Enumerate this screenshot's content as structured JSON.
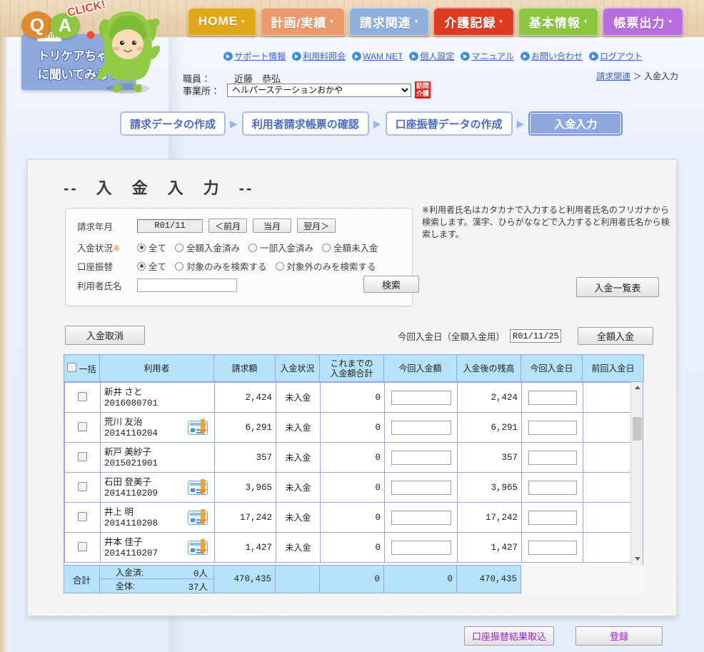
{
  "nav": {
    "tabs": [
      {
        "label": "HOME",
        "color": "#e0a818",
        "caret": "▾"
      },
      {
        "label": "計画/実績",
        "color": "#eb9a6b",
        "caret": "▾"
      },
      {
        "label": "請求関連",
        "color": "#8fb0dd",
        "caret": "▾"
      },
      {
        "label": "介護記録",
        "color": "#dd3c22",
        "caret": "▾"
      },
      {
        "label": "基本情報",
        "color": "#8cc63f",
        "caret": "▾"
      },
      {
        "label": "帳票出力",
        "color": "#b66ee0",
        "caret": "▾"
      }
    ]
  },
  "logo": {
    "q": "Q",
    "a": "A",
    "click": "CLICK!",
    "and": "and",
    "line1": "トリケアちゃん",
    "line2": "に聞いてみる！"
  },
  "header_links": [
    {
      "label": "サポート情報"
    },
    {
      "label": "利用料照会"
    },
    {
      "label": "WAM NET"
    },
    {
      "label": "個人設定"
    },
    {
      "label": "マニュアル"
    },
    {
      "label": "お問い合わせ"
    },
    {
      "label": "ログアウト"
    }
  ],
  "account": {
    "staff_label": "職員：",
    "staff_name": "近藤　恭弘",
    "office_label": "事業所：",
    "office_value": "ヘルパーステーションおかや",
    "service_badge_line1": "訪問",
    "service_badge_line2": "介護"
  },
  "breadcrumb": {
    "parent": "請求関連",
    "separator": "＞",
    "current": "入金入力"
  },
  "steps": [
    {
      "label": "請求データの作成",
      "active": false
    },
    {
      "label": "利用者請求帳票の確認",
      "active": false
    },
    {
      "label": "口座振替データの作成",
      "active": false
    },
    {
      "label": "入金入力",
      "active": true
    }
  ],
  "step_arrow": "▶",
  "panel": {
    "title": "--　入　金　入　力　--"
  },
  "search": {
    "ym_label": "請求年月",
    "ym_value": "R01/11",
    "prev_month": "＜前月",
    "this_month": "当月",
    "next_month": "翌月＞",
    "status_label": "入金状況",
    "status_req": "※",
    "status_options": [
      {
        "label": "全て",
        "selected": true
      },
      {
        "label": "全額入金済み",
        "selected": false
      },
      {
        "label": "一部入金済み",
        "selected": false
      },
      {
        "label": "全額未入金",
        "selected": false
      }
    ],
    "transfer_label": "口座振替",
    "transfer_options": [
      {
        "label": "全て",
        "selected": true
      },
      {
        "label": "対象のみを検索する",
        "selected": false
      },
      {
        "label": "対象外のみを検索する",
        "selected": false
      }
    ],
    "name_label": "利用者氏名",
    "name_value": "",
    "name_placeholder": "",
    "search_button": "検索"
  },
  "note": "※利用者氏名はカタカナで入力すると利用者氏名のフリガナから検索します。漢字、ひらがななどで入力すると利用者氏名から検索します。",
  "buttons": {
    "list_report": "入金一覧表",
    "cancel_payment": "入金取消",
    "paydate_label": "今回入金日（全額入金用）",
    "paydate_value": "R01/11/25",
    "full_payment": "全額入金",
    "import_transfer_result": "口座振替結果取込",
    "register": "登録"
  },
  "table": {
    "headers": {
      "bulk": "一括",
      "user": "利用者",
      "billed": "請求額",
      "status": "入金状況",
      "sofar_line1": "これまでの",
      "sofar_line2": "入金額合計",
      "now_amount": "今回入金額",
      "remaining": "入金後の残高",
      "now_date": "今回入金日",
      "prev_date": "前回入金日"
    },
    "rows": [
      {
        "checked": false,
        "name": "新井 さと",
        "id": "2016080701",
        "transfer": false,
        "billed": "2,424",
        "status": "未入金",
        "sofar": "0",
        "now_amount": "",
        "remaining": "2,424",
        "now_date": "",
        "prev_date": ""
      },
      {
        "checked": false,
        "name": "荒川 友治",
        "id": "2014110204",
        "transfer": true,
        "billed": "6,291",
        "status": "未入金",
        "sofar": "0",
        "now_amount": "",
        "remaining": "6,291",
        "now_date": "",
        "prev_date": ""
      },
      {
        "checked": false,
        "name": "新戸 美紗子",
        "id": "2015021901",
        "transfer": false,
        "billed": "357",
        "status": "未入金",
        "sofar": "0",
        "now_amount": "",
        "remaining": "357",
        "now_date": "",
        "prev_date": ""
      },
      {
        "checked": false,
        "name": "石田 登美子",
        "id": "2014110209",
        "transfer": true,
        "billed": "3,965",
        "status": "未入金",
        "sofar": "0",
        "now_amount": "",
        "remaining": "3,965",
        "now_date": "",
        "prev_date": ""
      },
      {
        "checked": false,
        "name": "井上 明",
        "id": "2014110208",
        "transfer": true,
        "billed": "17,242",
        "status": "未入金",
        "sofar": "0",
        "now_amount": "",
        "remaining": "17,242",
        "now_date": "",
        "prev_date": ""
      },
      {
        "checked": false,
        "name": "井本 佳子",
        "id": "2014110207",
        "transfer": true,
        "billed": "1,427",
        "status": "未入金",
        "sofar": "0",
        "now_amount": "",
        "remaining": "1,427",
        "now_date": "",
        "prev_date": ""
      }
    ],
    "totals": {
      "label": "合計",
      "paid_label": "入金済:",
      "paid_value": "0人",
      "all_label": "全体:",
      "all_value": "37人",
      "billed": "470,435",
      "sofar": "0",
      "now_amount": "0",
      "remaining": "470,435"
    }
  }
}
